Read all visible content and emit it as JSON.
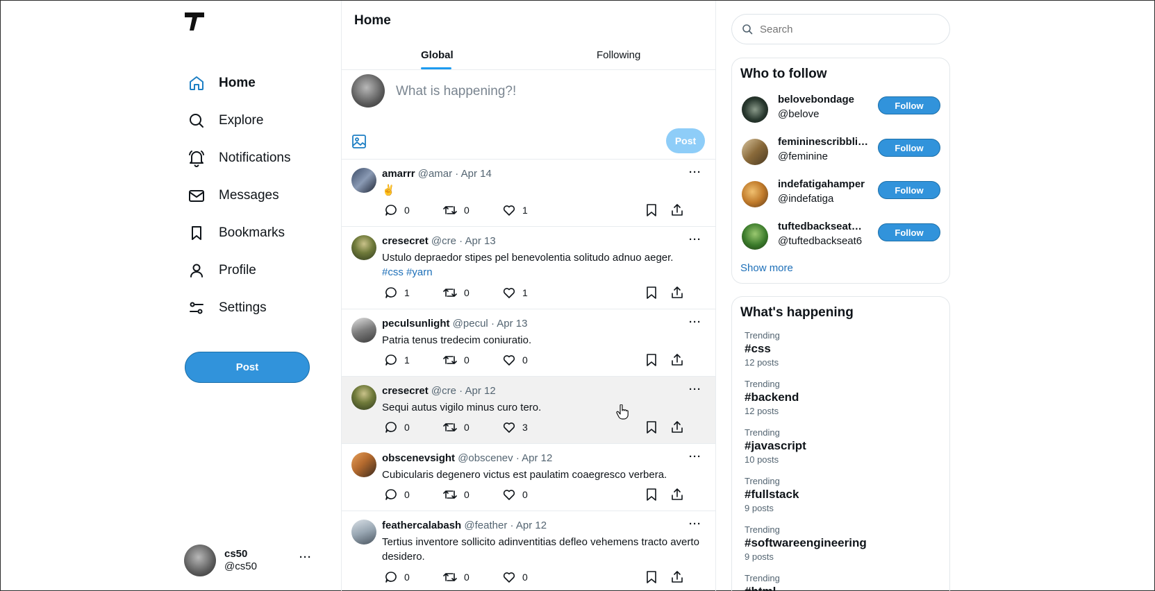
{
  "nav": {
    "items": [
      {
        "label": "Home",
        "icon": "home-icon",
        "active": true
      },
      {
        "label": "Explore",
        "icon": "search-icon"
      },
      {
        "label": "Notifications",
        "icon": "bell-icon"
      },
      {
        "label": "Messages",
        "icon": "mail-icon"
      },
      {
        "label": "Bookmarks",
        "icon": "bookmark-icon"
      },
      {
        "label": "Profile",
        "icon": "user-icon"
      },
      {
        "label": "Settings",
        "icon": "settings-icon"
      }
    ],
    "post_label": "Post",
    "account": {
      "name": "cs50",
      "handle": "@cs50",
      "more": "···"
    }
  },
  "main": {
    "title": "Home",
    "tabs": [
      {
        "label": "Global",
        "active": true
      },
      {
        "label": "Following"
      }
    ],
    "composer": {
      "placeholder": "What is happening?!",
      "post_label": "Post"
    },
    "tweets": [
      {
        "name": "amarrr",
        "handle": "@amar",
        "sep": "·",
        "date": "Apr 14",
        "text": "✌️",
        "tags": "",
        "replies": "0",
        "retweets": "0",
        "likes": "1"
      },
      {
        "name": "cresecret",
        "handle": "@cre",
        "sep": "·",
        "date": "Apr 13",
        "text": "Ustulo depraedor stipes pel benevolentia solitudo adnuo aeger.",
        "tags": "#css #yarn",
        "replies": "1",
        "retweets": "0",
        "likes": "1"
      },
      {
        "name": "peculsunlight",
        "handle": "@pecul",
        "sep": "·",
        "date": "Apr 13",
        "text": "Patria tenus tredecim coniuratio.",
        "tags": "",
        "replies": "1",
        "retweets": "0",
        "likes": "0"
      },
      {
        "name": "cresecret",
        "handle": "@cre",
        "sep": "·",
        "date": "Apr 12",
        "text": "Sequi autus vigilo minus curo tero.",
        "tags": "",
        "replies": "0",
        "retweets": "0",
        "likes": "3"
      },
      {
        "name": "obscenevsight",
        "handle": "@obscenev",
        "sep": "·",
        "date": "Apr 12",
        "text": "Cubicularis degenero victus est paulatim coaegresco verbera.",
        "tags": "",
        "replies": "0",
        "retweets": "0",
        "likes": "0"
      },
      {
        "name": "feathercalabash",
        "handle": "@feather",
        "sep": "·",
        "date": "Apr 12",
        "text": "Tertius inventore sollicito adinventitias defleo vehemens tracto averto desidero.",
        "tags": "",
        "replies": "0",
        "retweets": "0",
        "likes": "0"
      }
    ]
  },
  "sidebar": {
    "search_placeholder": "Search",
    "who_to_follow": {
      "title": "Who to follow",
      "follow_label": "Follow",
      "users": [
        {
          "name": "belovebondage",
          "handle": "@belove"
        },
        {
          "name": "femininescribbli…",
          "handle": "@feminine"
        },
        {
          "name": "indefatigahamper",
          "handle": "@indefatiga"
        },
        {
          "name": "tuftedbackseat…",
          "handle": "@tuftedbackseat6"
        }
      ],
      "show_more": "Show more"
    },
    "whats_happening": {
      "title": "What's happening",
      "trends": [
        {
          "kind": "Trending",
          "tag": "#css",
          "count": "12 posts"
        },
        {
          "kind": "Trending",
          "tag": "#backend",
          "count": "12 posts"
        },
        {
          "kind": "Trending",
          "tag": "#javascript",
          "count": "10 posts"
        },
        {
          "kind": "Trending",
          "tag": "#fullstack",
          "count": "9 posts"
        },
        {
          "kind": "Trending",
          "tag": "#softwareengineering",
          "count": "9 posts"
        },
        {
          "kind": "Trending",
          "tag": "#html",
          "count": ""
        }
      ]
    }
  }
}
